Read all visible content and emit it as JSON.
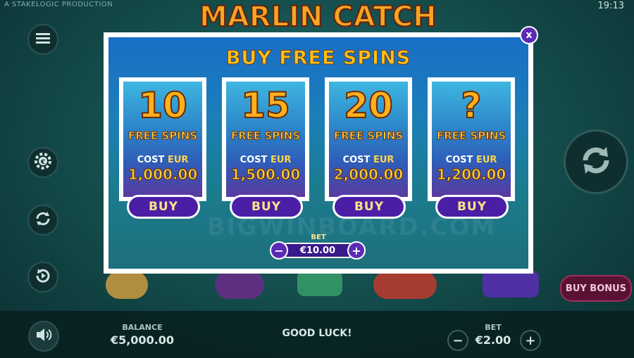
{
  "header": {
    "production_text": "A STAKELOGIC PRODUCTION",
    "clock": "19:13",
    "logo": "MARLIN CATCH"
  },
  "side_icons": [
    "menu-icon",
    "euro-settings-icon",
    "autoplay-icon",
    "turbo-icon"
  ],
  "spin_icon": "spin-icon",
  "buy_bonus_label": "BUY BONUS",
  "bottom": {
    "balance_label": "BALANCE",
    "balance_value": "€5,000.00",
    "message": "GOOD LUCK!",
    "bet_label": "BET",
    "bet_value": "€2.00",
    "minus": "−",
    "plus": "+"
  },
  "modal": {
    "title": "BUY FREE SPINS",
    "close": "x",
    "watermark": "BIGWINBOARD.COM",
    "cards": [
      {
        "count": "10",
        "free_spins": "FREE SPINS",
        "cost": "COST",
        "currency": "EUR",
        "amount": "1,000.00",
        "buy": "BUY"
      },
      {
        "count": "15",
        "free_spins": "FREE SPINS",
        "cost": "COST",
        "currency": "EUR",
        "amount": "1,500.00",
        "buy": "BUY"
      },
      {
        "count": "20",
        "free_spins": "FREE SPINS",
        "cost": "COST",
        "currency": "EUR",
        "amount": "2,000.00",
        "buy": "BUY"
      },
      {
        "count": "?",
        "free_spins": "FREE SPINS",
        "cost": "COST",
        "currency": "EUR",
        "amount": "1,200.00",
        "buy": "BUY"
      }
    ],
    "bet": {
      "label": "BET",
      "value": "€10.00",
      "minus": "−",
      "plus": "+"
    }
  },
  "colors": {
    "accent_purple": "#4a1fa6",
    "gold": "#ffc21d"
  }
}
